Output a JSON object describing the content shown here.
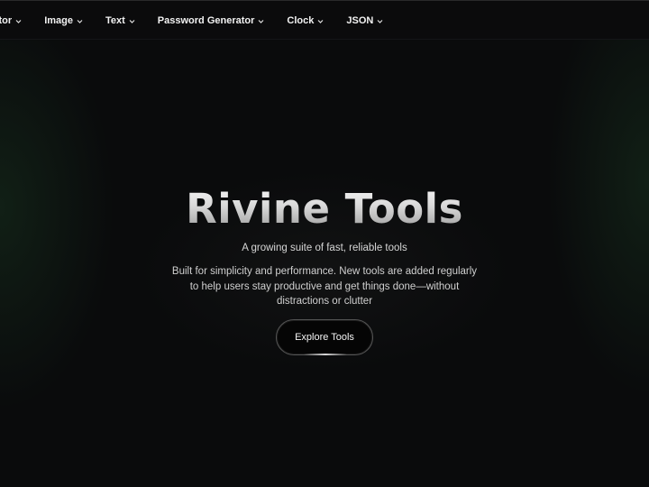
{
  "nav": {
    "items": [
      {
        "label": "erator",
        "icon": "chevron-down-icon"
      },
      {
        "label": "Image",
        "icon": "chevron-down-icon"
      },
      {
        "label": "Text",
        "icon": "chevron-down-icon"
      },
      {
        "label": "Password Generator",
        "icon": "chevron-down-icon"
      },
      {
        "label": "Clock",
        "icon": "chevron-down-icon"
      },
      {
        "label": "JSON",
        "icon": "chevron-down-icon"
      }
    ]
  },
  "hero": {
    "title": "Rivine Tools",
    "subtitle": "A growing suite of fast, reliable tools",
    "description": "Built for simplicity and performance. New tools are added regularly to help users stay productive and get things done—without distractions or clutter",
    "cta_label": "Explore Tools"
  },
  "colors": {
    "background": "#0a0b0c",
    "accent_glow": "#1e4628",
    "text": "#f2f2f2"
  }
}
